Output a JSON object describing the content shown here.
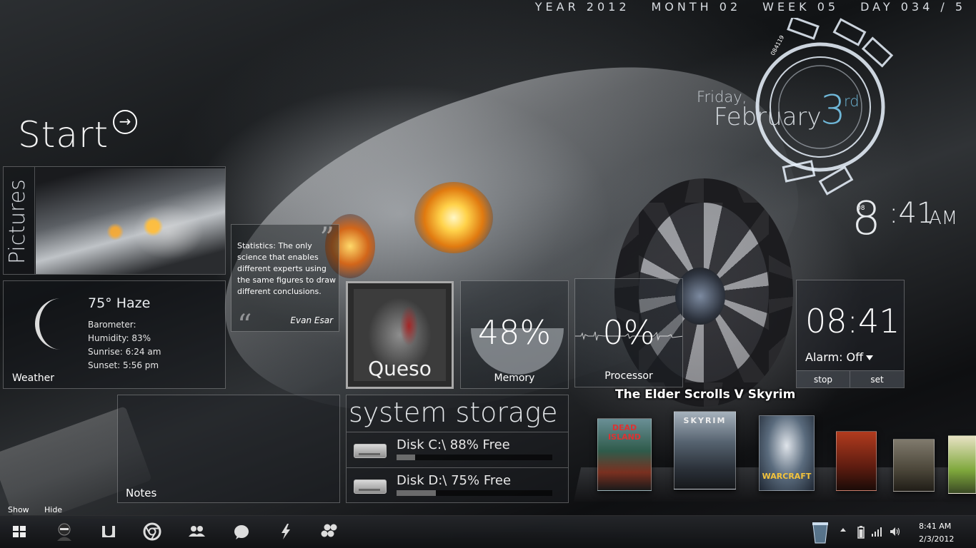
{
  "datebar": {
    "year": "YEAR 2012",
    "month": "MONTH 02",
    "week": "WEEK 05",
    "day": "DAY 034 / 5"
  },
  "start": {
    "title": "Start",
    "arrow_icon": "circle-arrow-right-icon"
  },
  "pictures": {
    "label": "Pictures"
  },
  "quote": {
    "text": "Statistics: The only science that enables different experts using the same figures to draw different conclusions.",
    "author": "Evan Esar",
    "open_mark": "“",
    "close_mark": "”"
  },
  "weather": {
    "temp": "75° Haze",
    "barometer": "Barometer:",
    "humidity": "Humidity: 83%",
    "sunrise": "Sunrise: 6:24 am",
    "sunset": "Sunset: 5:56 pm",
    "label": "Weather",
    "icon": "crescent-moon-icon"
  },
  "queso": {
    "label": "Queso"
  },
  "memory": {
    "value": "48%",
    "label": "Memory",
    "percent": 48
  },
  "processor": {
    "value": "0%",
    "label": "Processor",
    "percent": 0
  },
  "alarm": {
    "time": "08:41",
    "status": "Alarm: Off",
    "stop_label": "stop",
    "set_label": "set"
  },
  "notes": {
    "label": "Notes"
  },
  "storage": {
    "title": "system storage",
    "disks": [
      {
        "label": "Disk C:\\ 88% Free",
        "used_percent": 12
      },
      {
        "label": "Disk D:\\ 75% Free",
        "used_percent": 25
      }
    ]
  },
  "games": {
    "title": "The Elder Scrolls V Skyrim",
    "covers": [
      {
        "label": "DEAD ISLAND"
      },
      {
        "label": "SKYRIM"
      },
      {
        "label": "WARCRAFT"
      },
      {
        "label": ""
      },
      {
        "label": ""
      },
      {
        "label": ""
      }
    ]
  },
  "ring_clock": {
    "weekday": "Friday,",
    "month": "February",
    "day": "3",
    "day_suffix": "rd",
    "small_code": "084119",
    "small_hour": "08",
    "hour": "8",
    "minutes": ":41",
    "ampm": "AM"
  },
  "sidebar_controls": {
    "show": "Show",
    "hide": "Hide"
  },
  "taskbar": {
    "icons": [
      "windows-start-icon",
      "ninja-avatar-icon",
      "utorrent-icon",
      "chrome-icon",
      "people-icon",
      "messenger-icon",
      "winamp-icon",
      "honeycomb-icon"
    ],
    "tray_icons": [
      "recycle-bin-icon",
      "show-hidden-icons-icon",
      "battery-icon",
      "network-icon",
      "volume-icon"
    ],
    "time": "8:41 AM",
    "date": "2/3/2012"
  }
}
